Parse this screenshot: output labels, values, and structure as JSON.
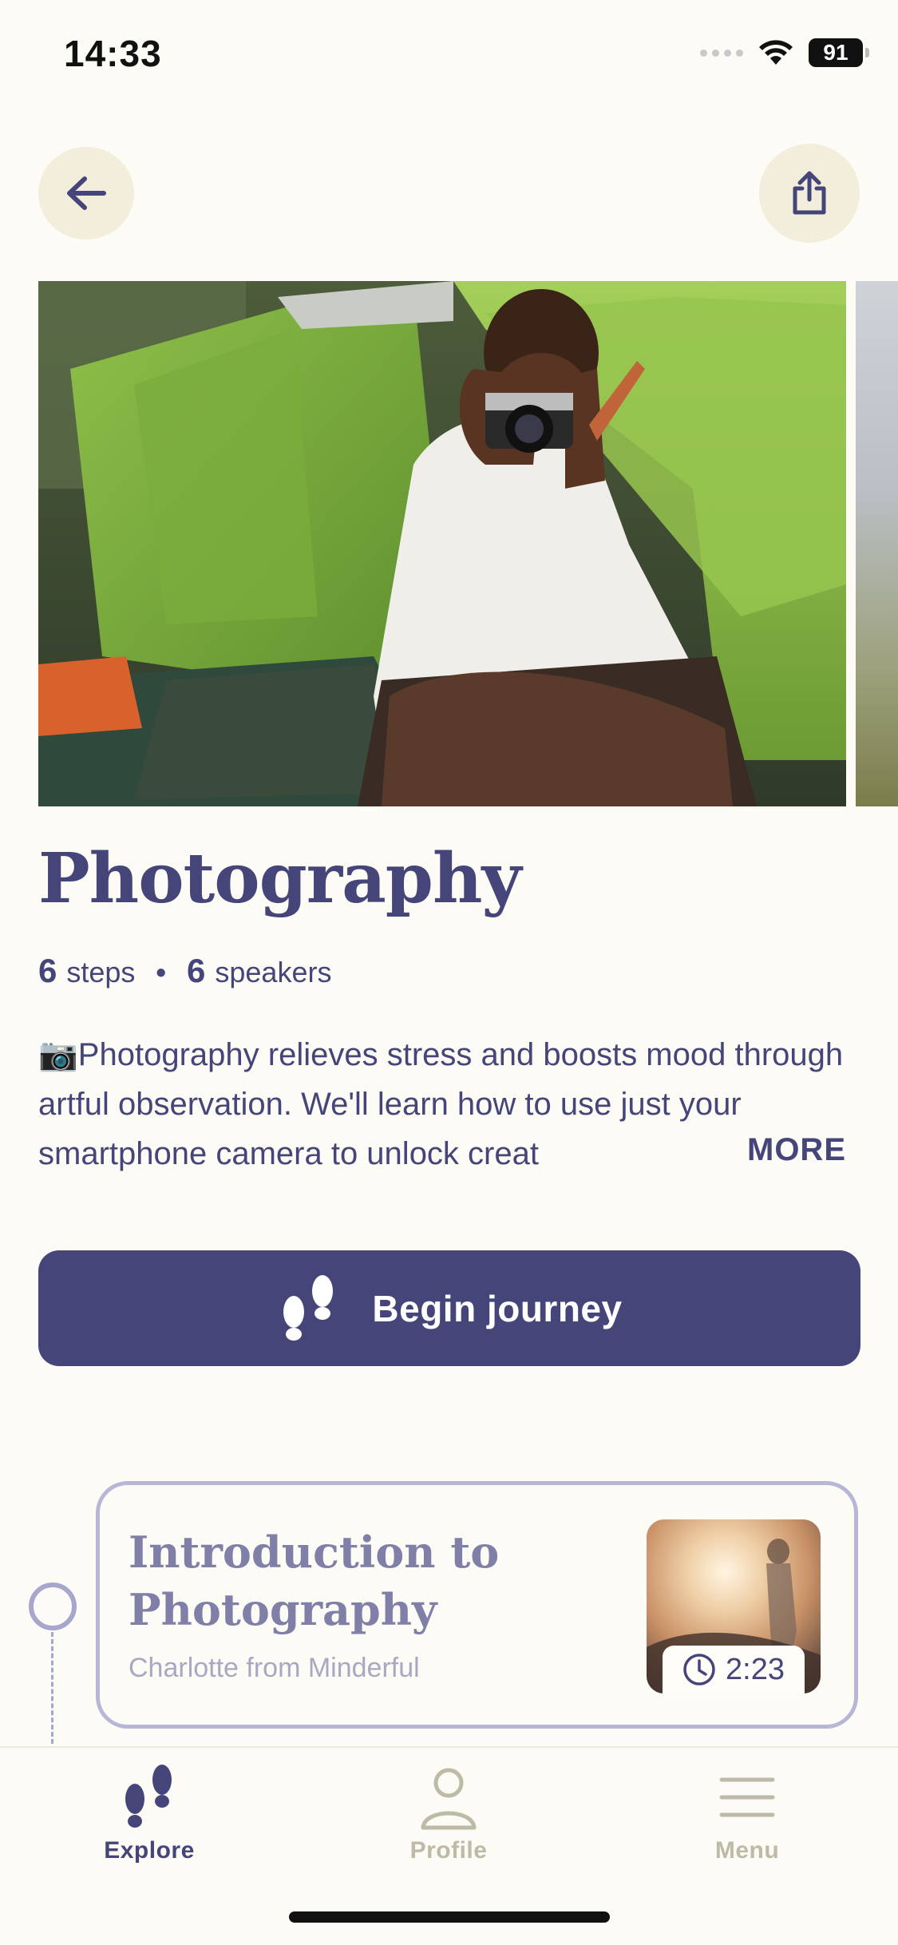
{
  "status_bar": {
    "time": "14:33",
    "battery": "91"
  },
  "header": {
    "back_icon": "arrow-left-icon",
    "share_icon": "share-icon"
  },
  "journey": {
    "title": "Photography",
    "steps_count": "6",
    "steps_label": "steps",
    "separator": "•",
    "speakers_count": "6",
    "speakers_label": "speakers",
    "description": "📷Photography relieves stress and boosts mood through artful observation. We'll learn how to use just your smartphone camera to unlock creat",
    "more_label": "MORE",
    "begin_button": "Begin journey"
  },
  "steps": [
    {
      "title": "Introduction to Photography",
      "speaker": "Charlotte from Minderful",
      "duration": "2:23"
    }
  ],
  "tab_bar": {
    "explore": "Explore",
    "profile": "Profile",
    "menu": "Menu"
  },
  "colors": {
    "primary": "#45457a",
    "background": "#fcfbf5",
    "button_bg": "#f3eddb",
    "muted": "#a9a8c2",
    "inactive_tab": "#bdbaa6"
  }
}
